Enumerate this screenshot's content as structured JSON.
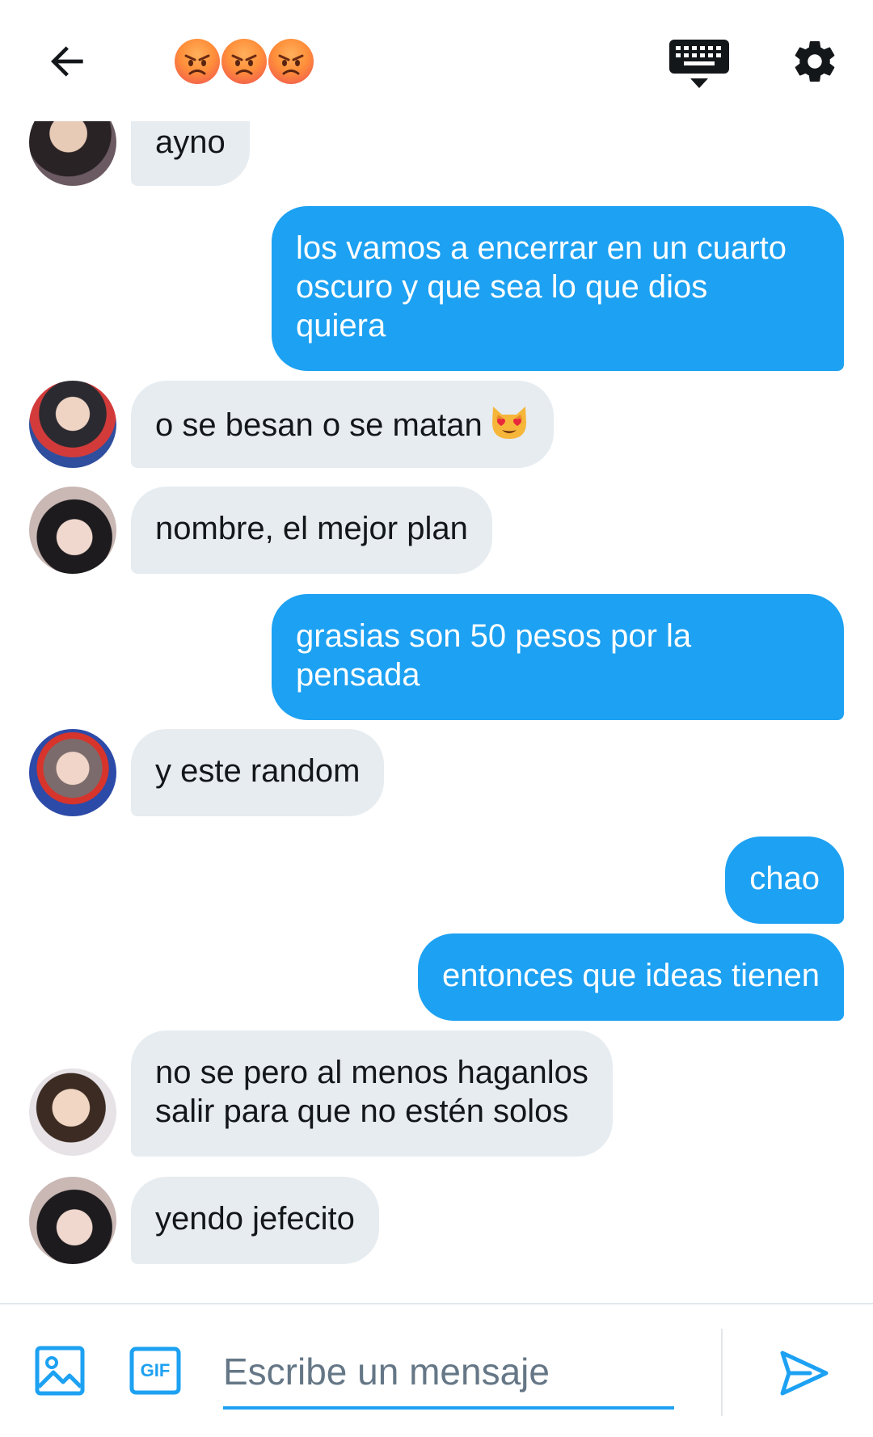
{
  "header": {
    "back_icon": "arrow-left-icon",
    "title_emoji": [
      "angry-face",
      "angry-face",
      "angry-face"
    ],
    "keyboard_icon": "keyboard-icon",
    "settings_icon": "gear-icon"
  },
  "messages": [
    {
      "side": "in",
      "lines": [
        "ayno"
      ]
    },
    {
      "side": "out",
      "lines": [
        "los vamos a encerrar en un cuarto",
        "oscuro y que sea lo que dios",
        "quiera"
      ]
    },
    {
      "side": "in",
      "lines": [
        "o se besan o se matan"
      ],
      "emoji": "smiling-cat-heart-eyes"
    },
    {
      "side": "in",
      "lines": [
        "nombre, el mejor plan"
      ]
    },
    {
      "side": "out",
      "lines": [
        "grasias son 50 pesos por la",
        "pensada"
      ]
    },
    {
      "side": "in",
      "lines": [
        "y este random"
      ]
    },
    {
      "side": "out",
      "lines": [
        "chao"
      ]
    },
    {
      "side": "out",
      "lines": [
        "entonces que ideas tienen"
      ]
    },
    {
      "side": "in",
      "lines": [
        "no se pero al menos haganlos",
        "salir para que no estén solos"
      ]
    },
    {
      "side": "in",
      "lines": [
        "yendo jefecito"
      ]
    }
  ],
  "composer": {
    "placeholder": "Escribe un mensaje",
    "gif_label": "GIF",
    "media_icon": "image-icon",
    "send_icon": "send-icon"
  },
  "colors": {
    "accent": "#1da1f2",
    "incoming_bubble": "#e6ecf0",
    "text": "#14171a",
    "muted": "#657786"
  }
}
